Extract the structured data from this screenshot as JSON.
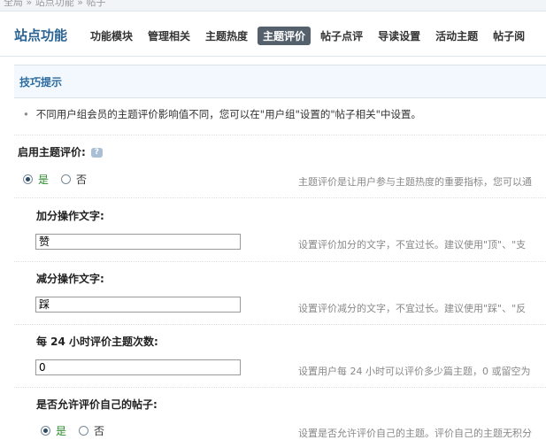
{
  "top_strip": {
    "breadcrumb": "全局 » 站点功能 » 帖子"
  },
  "header": {
    "title": "站点功能",
    "tabs": [
      {
        "label": "功能模块",
        "active": false
      },
      {
        "label": "管理相关",
        "active": false
      },
      {
        "label": "主题热度",
        "active": false
      },
      {
        "label": "主题评价",
        "active": true
      },
      {
        "label": "帖子点评",
        "active": false
      },
      {
        "label": "导读设置",
        "active": false
      },
      {
        "label": "活动主题",
        "active": false
      },
      {
        "label": "帖子阅",
        "active": false
      }
    ]
  },
  "tips": {
    "title": "技巧提示",
    "text": "不同用户组会员的主题评价影响值不同，您可以在\"用户组\"设置的\"帖子相关\"中设置。"
  },
  "settings": {
    "enable": {
      "label": "启用主题评价:",
      "help_icon": "question-icon",
      "yes": "是",
      "no": "否",
      "selected": "yes",
      "desc": "主题评价是让用户参与主题热度的重要指标，您可以通"
    },
    "add_text": {
      "label": "加分操作文字:",
      "value": "赞",
      "desc": "设置评价加分的文字，不宜过长。建议使用\"顶\"、\"支"
    },
    "sub_text": {
      "label": "减分操作文字:",
      "value": "踩",
      "desc": "设置评价减分的文字，不宜过长。建议使用\"踩\"、\"反"
    },
    "daily_count": {
      "label": "每 24 小时评价主题次数:",
      "value": "0",
      "desc": "设置用户每 24 小时可以评价多少篇主题，0 或留空为"
    },
    "self_rate": {
      "label": "是否允许评价自己的帖子:",
      "yes": "是",
      "no": "否",
      "selected": "yes",
      "desc": "设置是否允许评价自己的主题。评价自己的主题无积分"
    }
  }
}
